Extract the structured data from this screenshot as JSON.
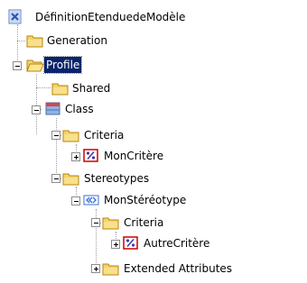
{
  "tree": {
    "root": {
      "label": "DéfinitionEtenduedeModèle",
      "icon": "model-definition-icon"
    },
    "nodes": [
      {
        "label": "Generation",
        "icon": "folder-icon",
        "expander": "none"
      },
      {
        "label": "Profile",
        "icon": "folder-open-icon",
        "expander": "expanded",
        "selected": true
      },
      {
        "label": "Shared",
        "icon": "folder-icon",
        "expander": "none"
      },
      {
        "label": "Class",
        "icon": "class-icon",
        "expander": "expanded"
      },
      {
        "label": "Criteria",
        "icon": "folder-icon",
        "expander": "expanded"
      },
      {
        "label": "MonCritère",
        "icon": "criterion-icon",
        "expander": "collapsed"
      },
      {
        "label": "Stereotypes",
        "icon": "folder-icon",
        "expander": "expanded"
      },
      {
        "label": "MonStéréotype",
        "icon": "stereotype-icon",
        "expander": "expanded"
      },
      {
        "label": "Criteria",
        "icon": "folder-icon",
        "expander": "expanded"
      },
      {
        "label": "AutreCritère",
        "icon": "criterion-icon",
        "expander": "collapsed"
      },
      {
        "label": "Extended Attributes",
        "icon": "folder-icon",
        "expander": "collapsed"
      }
    ]
  },
  "colors": {
    "selection": "#0a246a",
    "folder": "#f5d36b",
    "folder_border": "#b8860b",
    "criterion": "#cc0000",
    "stereotype": "#3a6fd8",
    "class_header": "#d64545",
    "class_body": "#8fb3e8"
  }
}
